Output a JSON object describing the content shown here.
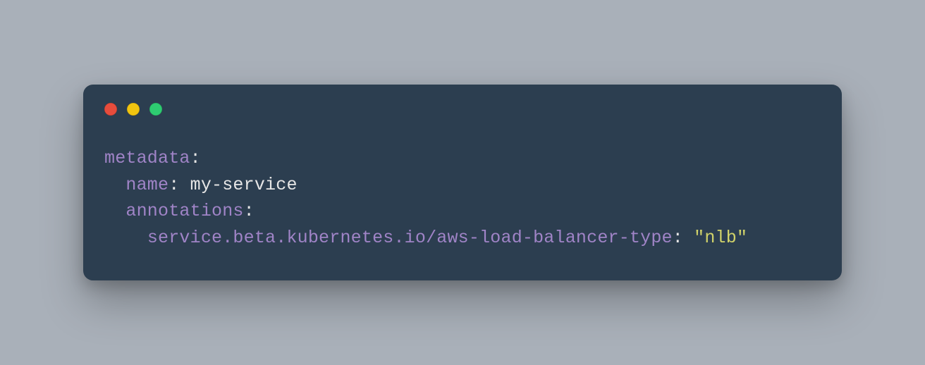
{
  "code": {
    "line1_key": "metadata",
    "colon": ":",
    "line2_key": "name",
    "line2_val": "my-service",
    "line3_key": "annotations",
    "line4_key": "service.beta.kubernetes.io/aws-load-balancer-type",
    "line4_val": "\"nlb\"",
    "indent1": "  ",
    "indent2": "    "
  }
}
